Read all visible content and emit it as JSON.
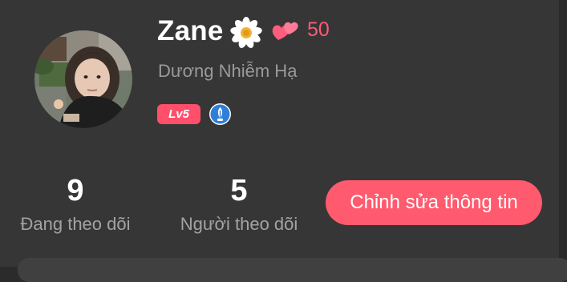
{
  "profile": {
    "display_name": "Zane",
    "hearts_count": "50",
    "subtitle": "Dương Nhiễm Hạ",
    "level": "Lv5"
  },
  "stats": {
    "following_count": "9",
    "following_label": "Đang theo dõi",
    "followers_count": "5",
    "followers_label": "Người theo dõi"
  },
  "actions": {
    "edit_profile_label": "Chỉnh sửa thông tin"
  },
  "icons": {
    "name_decoration": "daisy-flower-icon",
    "hearts": "two-hearts-icon",
    "verified": "blue-quill-badge-icon"
  },
  "colors": {
    "background": "#363636",
    "accent": "#ff5a6e",
    "heart_count": "#ff5a76",
    "badge_blue": "#2f7fd9"
  }
}
